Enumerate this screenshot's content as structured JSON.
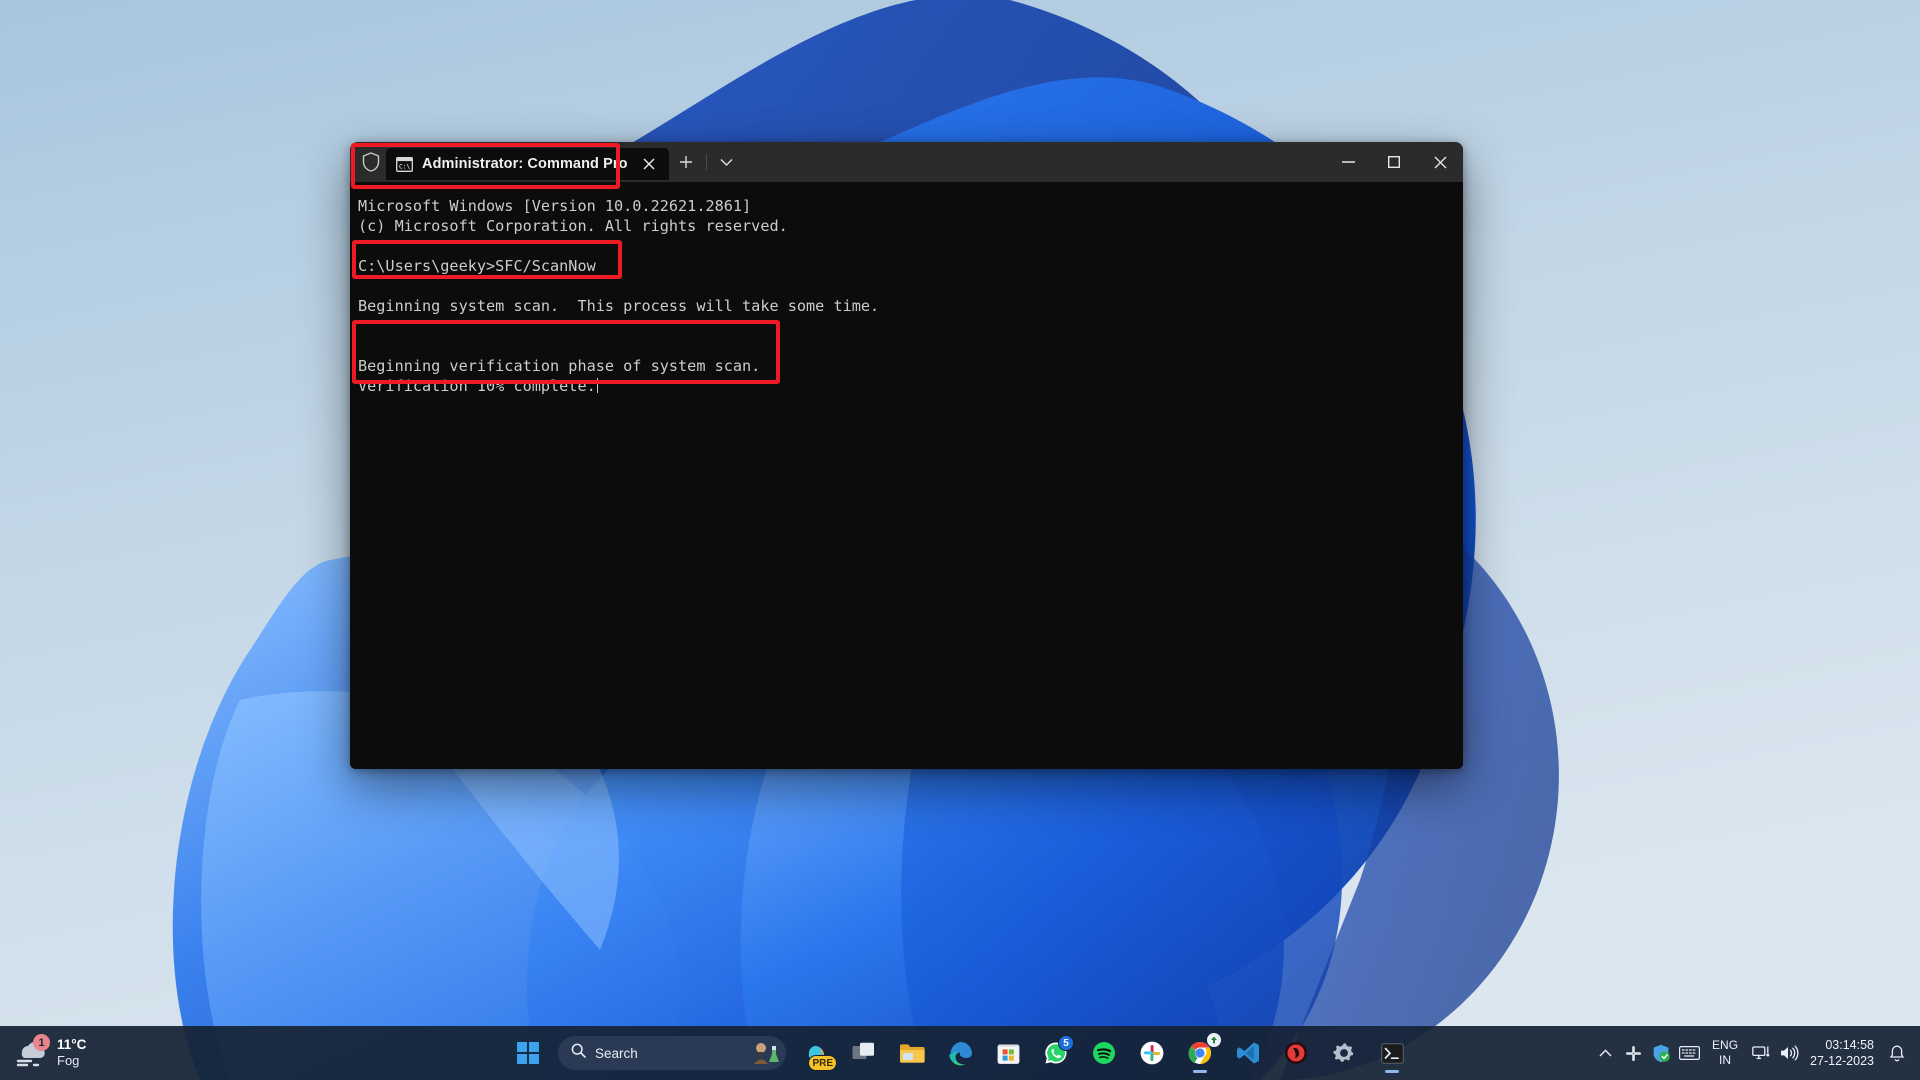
{
  "window": {
    "tab": {
      "title": "Administrator: Command Pro",
      "shield_icon": "shield-icon",
      "app_icon": "cmd-icon",
      "close_icon": "close-icon"
    },
    "new_tab_label": "+",
    "dropdown_icon": "chevron-down-icon",
    "controls": {
      "minimize": "minimize-icon",
      "maximize": "maximize-icon",
      "close": "close-icon"
    }
  },
  "terminal": {
    "lines": [
      "Microsoft Windows [Version 10.0.22621.2861]",
      "(c) Microsoft Corporation. All rights reserved.",
      "",
      "C:\\Users\\geeky>SFC/ScanNow",
      "",
      "Beginning system scan.  This process will take some time.",
      "",
      "",
      "Beginning verification phase of system scan.",
      "Verification 10% complete."
    ],
    "version_line": "Microsoft Windows [Version 10.0.22621.2861]",
    "copyright_line": "(c) Microsoft Corporation. All rights reserved.",
    "prompt_line": "C:\\Users\\geeky>SFC/ScanNow",
    "scan_line": "Beginning system scan.  This process will take some time.",
    "verify_line": "Beginning verification phase of system scan.",
    "progress_line": "Verification 10% complete.",
    "progress_percent": "10%",
    "foreground_color": "#cccccc",
    "background_color": "#0c0c0c"
  },
  "annotations": {
    "color": "#ee1b24",
    "boxes": [
      {
        "name": "tab-highlight",
        "target": "Administrator: Command Pro"
      },
      {
        "name": "command-highlight",
        "target": "C:\\Users\\geeky>SFC/ScanNow"
      },
      {
        "name": "verification-highlight",
        "target": "Beginning verification phase of system scan. / Verification 10% complete."
      }
    ]
  },
  "taskbar": {
    "weather": {
      "temperature": "11°C",
      "condition": "Fog",
      "badge": "1",
      "icon": "fog-cloud-icon"
    },
    "start_label": "Start",
    "search": {
      "placeholder": "Search",
      "icon": "search-icon"
    },
    "apps": [
      {
        "name": "copilot-icon",
        "label": "Copilot",
        "badge": "PRE"
      },
      {
        "name": "task-view-icon",
        "label": "Task View"
      },
      {
        "name": "file-explorer-icon",
        "label": "File Explorer"
      },
      {
        "name": "edge-icon",
        "label": "Microsoft Edge"
      },
      {
        "name": "microsoft-store-icon",
        "label": "Microsoft Store"
      },
      {
        "name": "whatsapp-icon",
        "label": "WhatsApp",
        "badge": "5"
      },
      {
        "name": "spotify-icon",
        "label": "Spotify"
      },
      {
        "name": "slack-icon",
        "label": "Slack"
      },
      {
        "name": "chrome-icon",
        "label": "Google Chrome"
      },
      {
        "name": "vscode-icon",
        "label": "Visual Studio Code"
      },
      {
        "name": "red-app-icon",
        "label": "App"
      },
      {
        "name": "settings-icon",
        "label": "Settings"
      },
      {
        "name": "terminal-icon",
        "label": "Terminal"
      }
    ],
    "tray": {
      "overflow_icon": "chevron-up-icon",
      "slack_icon": "slack-tray-icon",
      "defender_icon": "shield-check-icon",
      "keyboard_icon": "keyboard-icon",
      "language": "ENG",
      "region": "IN",
      "network_icon": "network-icon",
      "volume_icon": "volume-icon",
      "time": "03:14:58",
      "date": "27-12-2023",
      "notification_icon": "bell-icon"
    }
  }
}
